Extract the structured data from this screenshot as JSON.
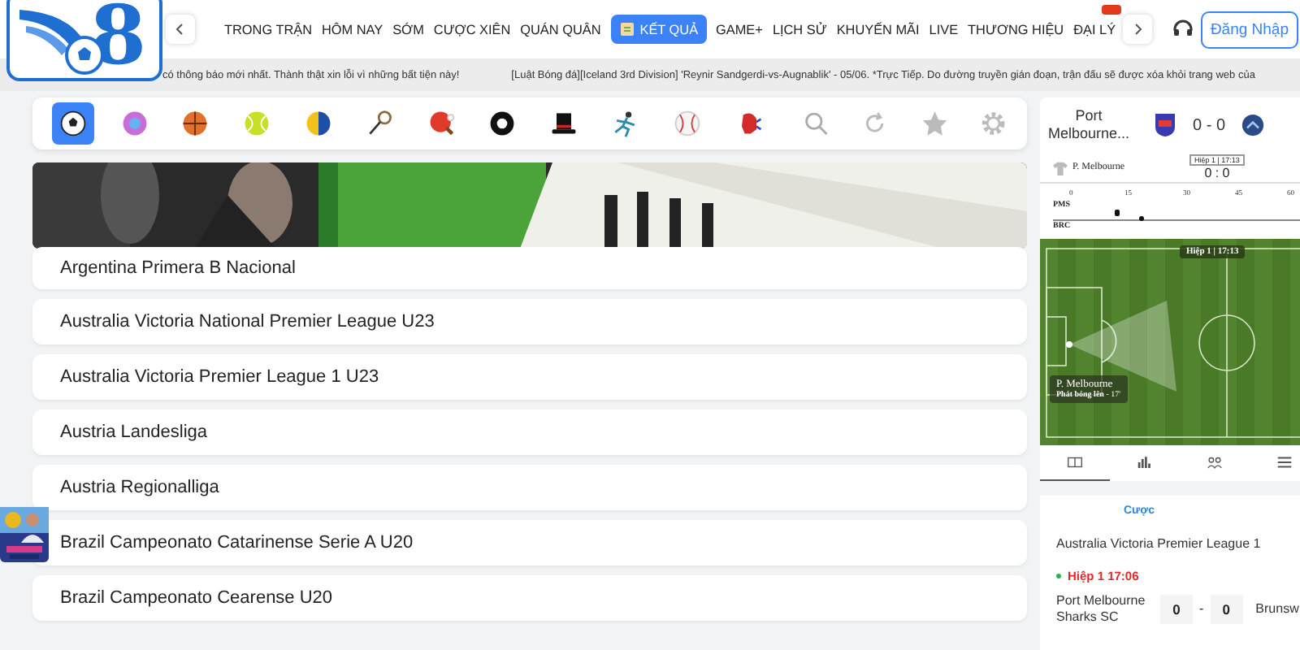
{
  "logo": {
    "text": "8"
  },
  "nav": [
    {
      "label": "TRONG TRẬN",
      "selected": false,
      "badge": false
    },
    {
      "label": "HÔM NAY",
      "selected": false,
      "badge": false
    },
    {
      "label": "SỚM",
      "selected": false,
      "badge": false
    },
    {
      "label": "CƯỢC XIÊN",
      "selected": false,
      "badge": false
    },
    {
      "label": "QUÁN QUÂN",
      "selected": false,
      "badge": false
    },
    {
      "label": "KẾT QUẢ",
      "selected": true,
      "badge": false
    },
    {
      "label": "GAME+",
      "selected": false,
      "badge": false
    },
    {
      "label": "LỊCH SỬ",
      "selected": false,
      "badge": false
    },
    {
      "label": "KHUYẾN MÃI",
      "selected": false,
      "badge": false
    },
    {
      "label": "LIVE",
      "selected": false,
      "badge": false
    },
    {
      "label": "THƯƠNG HIỆU",
      "selected": false,
      "badge": false
    },
    {
      "label": "ĐẠI LÝ",
      "selected": false,
      "badge": true
    }
  ],
  "login_button": "Đăng Nhập",
  "ticker": [
    "có thông báo mới nhất. Thành thật xin lỗi vì những bất tiện này!",
    "[Luật Bóng đá][Iceland 3rd Division] 'Reynir Sandgerdi-vs-Augnablik' - 05/06. *Trực Tiếp. Do đường truyền gián đoạn, trận đấu sẽ được xóa khỏi trang web của"
  ],
  "sports": [
    {
      "kind": "soccer",
      "selected": true
    },
    {
      "kind": "esports",
      "selected": false
    },
    {
      "kind": "basketball",
      "selected": false
    },
    {
      "kind": "tennis",
      "selected": false
    },
    {
      "kind": "volleyball",
      "selected": false
    },
    {
      "kind": "badminton",
      "selected": false
    },
    {
      "kind": "table-tennis",
      "selected": false
    },
    {
      "kind": "pool",
      "selected": false
    },
    {
      "kind": "hat",
      "selected": false
    },
    {
      "kind": "athletics",
      "selected": false
    },
    {
      "kind": "baseball",
      "selected": false
    },
    {
      "kind": "boxing",
      "selected": false
    }
  ],
  "leagues": [
    "Argentina Primera B Nacional",
    "Australia Victoria National Premier League U23",
    "Australia Victoria Premier League 1 U23",
    "Austria Landesliga",
    "Austria Regionalliga",
    "Brazil Campeonato Catarinense Serie A U20",
    "Brazil Campeonato Cearense U20"
  ],
  "match": {
    "home": "Port Melbourne...",
    "score": "0 - 0",
    "team_label": "P. Melbourne",
    "period_box": "Hiệp 1 | 17:13",
    "mini_score": "0 : 0",
    "timeline": {
      "ticks": [
        "0",
        "15",
        "30",
        "45",
        "60"
      ],
      "rows": [
        "PMS",
        "BRC"
      ]
    },
    "pitch": {
      "clock": "Hiệp 1 | 17:13",
      "team": "P. Melbourne",
      "event": "Phát bóng lên",
      "minute": "- 17'"
    },
    "tabs": [
      {
        "kind": "scoreboard",
        "selected": true
      },
      {
        "kind": "stats",
        "selected": false
      },
      {
        "kind": "lineup",
        "selected": false
      },
      {
        "kind": "list",
        "selected": false
      }
    ]
  },
  "bet": {
    "title": "Cược",
    "league": "Australia Victoria Premier League 1",
    "status": "Hiệp 1 17:06",
    "home": "Port Melbourne Sharks SC",
    "home_score": "0",
    "score_separator": "-",
    "away_score": "0",
    "away": "Brunsw"
  }
}
